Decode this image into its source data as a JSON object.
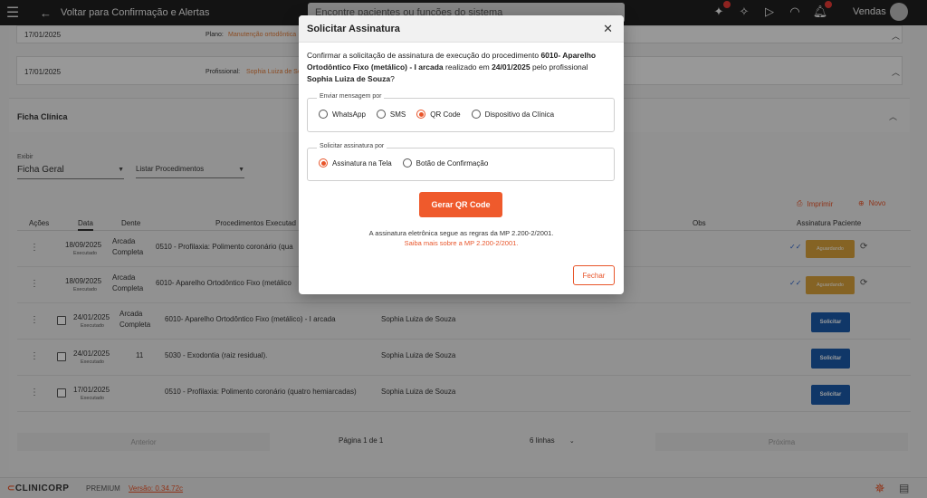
{
  "topbar": {
    "back_label": "Voltar para Confirmação e Alertas",
    "search_placeholder": "Encontre pacientes ou funções do sistema",
    "user_name": "Vendas"
  },
  "cards": [
    {
      "date": "17/01/2025",
      "label": "Plano:",
      "value": "Manutenção ortodôntica"
    },
    {
      "date": "17/01/2025",
      "label": "Profissional:",
      "value": "Sophia Luiza de So"
    }
  ],
  "ficha": {
    "title": "Ficha Clínica",
    "exibir_label": "Exibir",
    "exibir_value": "Ficha Geral",
    "procedimentos_label": "Listar Procedimentos",
    "imprimir_label": "Imprimir",
    "novo_label": "Novo"
  },
  "table": {
    "headers": {
      "acoes": "Ações",
      "data": "Data",
      "dente": "Dente",
      "procedimentos": "Procedimentos Executad",
      "obs": "Obs",
      "assinatura": "Assinatura Paciente"
    },
    "rows": [
      {
        "date": "18/09/2025",
        "status": "Executado",
        "dente_l1": "Arcada",
        "dente_l2": "Completa",
        "proc": "0510 - Profilaxia: Polimento coronário (qua",
        "prof": "",
        "action": "Aguardando"
      },
      {
        "date": "18/09/2025",
        "status": "Executado",
        "dente_l1": "Arcada",
        "dente_l2": "Completa",
        "proc": "6010- Aparelho Ortodôntico Fixo (metálico",
        "prof": "",
        "action": "Aguardando"
      },
      {
        "date": "24/01/2025",
        "status": "Executado",
        "dente_l1": "Arcada",
        "dente_l2": "Completa",
        "proc": "6010- Aparelho Ortodôntico Fixo (metálico) - I arcada",
        "prof": "Sophia Luiza de Souza",
        "action": "Solicitar"
      },
      {
        "date": "24/01/2025",
        "status": "Executado",
        "dente_l1": "11",
        "dente_l2": "",
        "proc": "5030 - Exodontia (raiz residual).",
        "prof": "Sophia Luiza de Souza",
        "action": "Solicitar"
      },
      {
        "date": "17/01/2025",
        "status": "Executado",
        "dente_l1": "",
        "dente_l2": "",
        "proc": "0510 - Profilaxia: Polimento coronário (quatro hemiarcadas)",
        "prof": "Sophia Luiza de Souza",
        "action": "Solicitar"
      }
    ]
  },
  "pager": {
    "prev": "Anterior",
    "page": "Página 1 de 1",
    "rows": "6 linhas",
    "next": "Próxima"
  },
  "footer": {
    "logo": "CLINICORP",
    "plan": "PREMIUM",
    "version": "Versão: 0.34.72c"
  },
  "modal": {
    "title": "Solicitar Assinatura",
    "intro_prefix": "Confirmar a solicitação de assinatura de execução do procedimento ",
    "procedure": "6010- Aparelho Ortodôntico Fixo (metálico) - I arcada",
    "intro_mid": " realizado em ",
    "date": "24/01/2025",
    "intro_mid2": " pelo profissional ",
    "professional": "Sophia Luiza de Souza",
    "intro_end": "?",
    "send_legend": "Enviar mensagem por",
    "send_options": [
      "WhatsApp",
      "SMS",
      "QR Code",
      "Dispositivo da Clínica"
    ],
    "send_selected": "QR Code",
    "request_legend": "Solicitar assinatura por",
    "request_options": [
      "Assinatura na Tela",
      "Botão de Confirmação"
    ],
    "request_selected": "Assinatura na Tela",
    "generate_label": "Gerar QR Code",
    "note": "A assinatura eletrônica segue as regras da MP 2.200-2/2001.",
    "note_link": "Saiba mais sobre a MP 2.200-2/2001.",
    "close_label": "Fechar"
  }
}
